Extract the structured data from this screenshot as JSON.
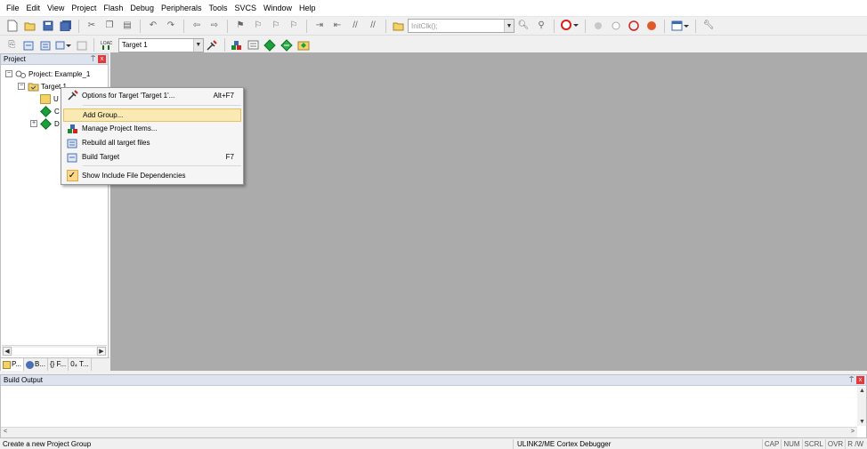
{
  "menubar": {
    "items": [
      "File",
      "Edit",
      "View",
      "Project",
      "Flash",
      "Debug",
      "Peripherals",
      "Tools",
      "SVCS",
      "Window",
      "Help"
    ]
  },
  "toolbar": {
    "function_combo": "InitClk();",
    "target_combo": "Target 1"
  },
  "project_panel": {
    "title": "Project",
    "pin": "⍑",
    "close": "x",
    "tree": {
      "root": "Project: Example_1",
      "target": "Target 1",
      "children": [
        "U",
        "C",
        "D"
      ]
    },
    "tabs": [
      "P...",
      "B...",
      "{} F...",
      "0₄ T..."
    ]
  },
  "context_menu": {
    "items": [
      {
        "label": "Options for Target 'Target 1'...",
        "shortcut": "Alt+F7"
      },
      {
        "label": "Add Group...",
        "shortcut": ""
      },
      {
        "label": "Manage Project Items...",
        "shortcut": ""
      },
      {
        "label": "Rebuild all target files",
        "shortcut": ""
      },
      {
        "label": "Build Target",
        "shortcut": "F7"
      },
      {
        "label": "Show Include File Dependencies",
        "shortcut": ""
      }
    ]
  },
  "build_output": {
    "title": "Build Output"
  },
  "status_bar": {
    "message": "Create a new Project Group",
    "debugger": "ULINK2/ME Cortex Debugger",
    "keys": [
      "CAP",
      "NUM",
      "SCRL",
      "OVR",
      "R /W"
    ]
  },
  "colors": {
    "editor_bg": "#ababab",
    "highlight": "#fbe9b4",
    "panel_title": "#dde4ef"
  }
}
